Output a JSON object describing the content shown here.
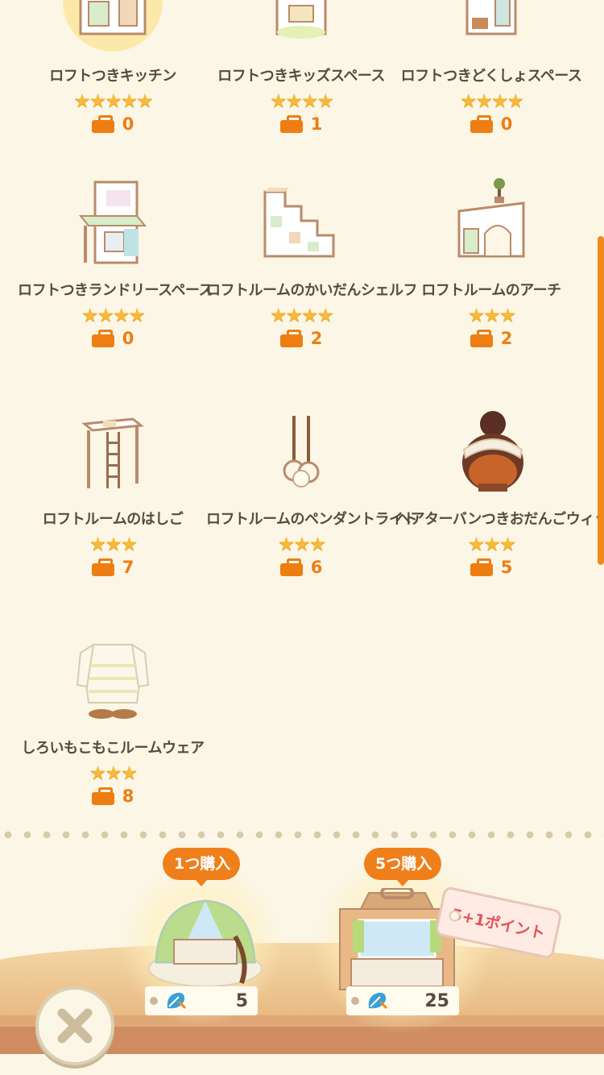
{
  "items": [
    {
      "name": "ロフトつきキッチン",
      "stars": "★★★★★",
      "owned": "0",
      "icon": "loft-kitchen-icon"
    },
    {
      "name": "ロフトつきキッズスペース",
      "stars": "★★★★",
      "owned": "1",
      "icon": "loft-kids-space-icon"
    },
    {
      "name": "ロフトつきどくしょスペース",
      "stars": "★★★★",
      "owned": "0",
      "icon": "loft-reading-space-icon"
    },
    {
      "name": "ロフトつきランドリースペース",
      "stars": "★★★★",
      "owned": "0",
      "icon": "loft-laundry-space-icon"
    },
    {
      "name": "ロフトルームのかいだんシェルフ",
      "stars": "★★★★",
      "owned": "2",
      "icon": "loft-stair-shelf-icon"
    },
    {
      "name": "ロフトルームのアーチ",
      "stars": "★★★",
      "owned": "2",
      "icon": "loft-arch-icon"
    },
    {
      "name": "ロフトルームのはしご",
      "stars": "★★★",
      "owned": "7",
      "icon": "loft-ladder-icon"
    },
    {
      "name": "ロフトルームのペンダントライト",
      "stars": "★★★",
      "owned": "6",
      "icon": "loft-pendant-light-icon"
    },
    {
      "name": "ヘアターバンつきおだんごウィッグ",
      "stars": "★★★",
      "owned": "5",
      "icon": "bun-wig-icon"
    },
    {
      "name": "しろいもこもこルームウェア",
      "stars": "★★★",
      "owned": "8",
      "icon": "fluffy-roomwear-icon"
    }
  ],
  "purchase": {
    "single": {
      "label": "1つ購入",
      "price": "5",
      "icon": "leaf-ticket-icon"
    },
    "bundle": {
      "label": "5つ購入",
      "price": "25",
      "bonus": "5+1ポイント",
      "icon": "leaf-ticket-icon"
    }
  },
  "close_icon": "close-x-icon",
  "colors": {
    "accent": "#ef7f1a",
    "star": "#f6b93b",
    "background": "#fbf6e6",
    "bonus_text": "#e0545a"
  }
}
